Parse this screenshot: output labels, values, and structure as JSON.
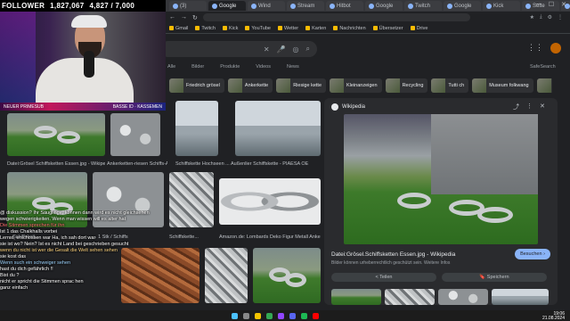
{
  "overlay": {
    "follower_label": "FOLLOWER",
    "follower_count": "1,827,067",
    "follower_goal": "4,827 / 7,000",
    "banner_left": "NEUER PRIMESUB",
    "banner_right": "BASSE ID · KASSEMEN"
  },
  "browser": {
    "tabs": [
      "(3)",
      "Google",
      "Wind",
      "Stream",
      "Hitbot",
      "Google",
      "Twitch",
      "Google",
      "Kick",
      "Seite",
      "Google",
      "Wiki",
      "Google",
      "Google",
      "YouTube",
      "Google",
      "Maps",
      "Reddit",
      "Google"
    ],
    "extensions": [
      "★",
      "⤓",
      "⚙",
      "⋮"
    ],
    "bookmarks": [
      "Gmail",
      "Twitch",
      "Kick",
      "YouTube",
      "Wetter",
      "Karten",
      "Nachrichten",
      "Übersetzer",
      "Drive"
    ]
  },
  "search": {
    "filters": [
      "Alle",
      "Bilder",
      "Produkte",
      "Videos",
      "News"
    ],
    "safesearch": "SafeSearch",
    "chips": [
      "Friedrich grösel",
      "Ankerkette",
      "Riesige kette",
      "Kleinanzeigen",
      "Recycling",
      "Tutti ch",
      "Museum folkwang",
      "Anke"
    ]
  },
  "results": {
    "captions": [
      "Datei:Grösel Schiffsketten Essen.jpg - Wikipe",
      "Ankerketten-riesen Schiffs-Ankerr",
      "Schiffskette Hochseen ...",
      "Außenlier Schiffskette - PIAESA OE",
      "... Schiffskett...",
      "... 1 Stk / Schiffs",
      "Schiffskette...",
      "Amazon.de: Lombards Deko Figur Metall Ankerk"
    ]
  },
  "panel": {
    "source": "Wikipedia",
    "title": "Datei:Grösel.Schiffsketten Essen.jpg - Wikipedia",
    "subtitle": "Bilder können urheberrechtlich geschützt sein. Weitere Infos",
    "visit": "Besuchen ›",
    "share": "< Teilen",
    "save": "🔖 Speichern"
  },
  "chat": [
    {
      "user": "",
      "color": "#ffffff",
      "text": "@ diskussion? Ihr Säuglinge, können dann wird es nicht gleichsehen"
    },
    {
      "user": "",
      "color": "#ffffff",
      "text": "wegen schwierigkeiten. Wenn man wissen will es alter hat"
    },
    {
      "user": "",
      "color": "#ff7070",
      "text": "Die Stimmen sprechen für ihn"
    },
    {
      "user": "",
      "color": "#ffffff",
      "text": "Ist 1 das Chalkhalls vorbei"
    },
    {
      "user": "",
      "color": "#ffffff",
      "text": "Lernst, erschossen war Ha, ich sah dort war"
    },
    {
      "user": "",
      "color": "#ffffff",
      "text": "sie ist wo? Nein? Ist es nicht Land bei geschrieben gesucht"
    },
    {
      "user": "",
      "color": "#ffd580",
      "text": "wenn du nicht ist wer die Gesalt die Welt sehen sehen"
    },
    {
      "user": "",
      "color": "#ffffff",
      "text": "sie kost das"
    },
    {
      "user": "",
      "color": "#9fd5ff",
      "text": "Wenn such ein schweiger sehen"
    },
    {
      "user": "",
      "color": "#ffffff",
      "text": "hast du dich gefährlich !!"
    },
    {
      "user": "",
      "color": "#ffffff",
      "text": "Bist du ?"
    },
    {
      "user": "",
      "color": "#ffffff",
      "text": "nicht er spricht die Stimmen sprac hen"
    },
    {
      "user": "",
      "color": "#ffffff",
      "text": "ganz einfach"
    }
  ],
  "taskbar": {
    "time": "19:06",
    "date": "21.08.2024"
  }
}
